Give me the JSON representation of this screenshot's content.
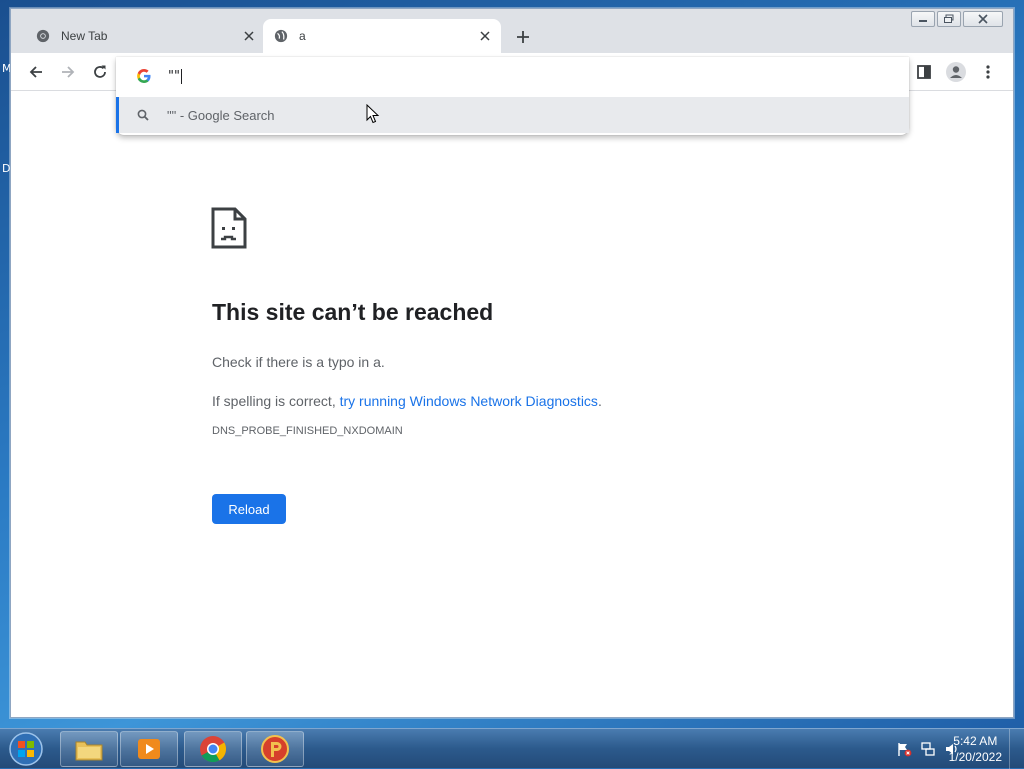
{
  "desktop": {
    "label_m": "M",
    "label_d": "D"
  },
  "browser": {
    "tabs": [
      {
        "title": "New Tab",
        "icon": "chrome-icon",
        "active": false
      },
      {
        "title": "a",
        "icon": "globe-icon",
        "active": true
      }
    ],
    "omnibox": {
      "typed_text": "\"\"",
      "suggestion": "\"\" - Google Search"
    }
  },
  "error_page": {
    "title": "This site can’t be reached",
    "line1": "Check if there is a typo in a.",
    "line2_prefix": "If spelling is correct, ",
    "line2_link": "try running Windows Network Diagnostics",
    "line2_suffix": ".",
    "error_code": "DNS_PROBE_FINISHED_NXDOMAIN",
    "reload_label": "Reload"
  },
  "taskbar": {
    "items": [
      "explorer-icon",
      "media-player-icon",
      "chrome-icon",
      "app-p-icon"
    ],
    "clock_time": "5:42 AM",
    "clock_date": "1/20/2022"
  },
  "colors": {
    "accent": "#1a73e8",
    "title": "#202124",
    "text": "#5f6368"
  }
}
